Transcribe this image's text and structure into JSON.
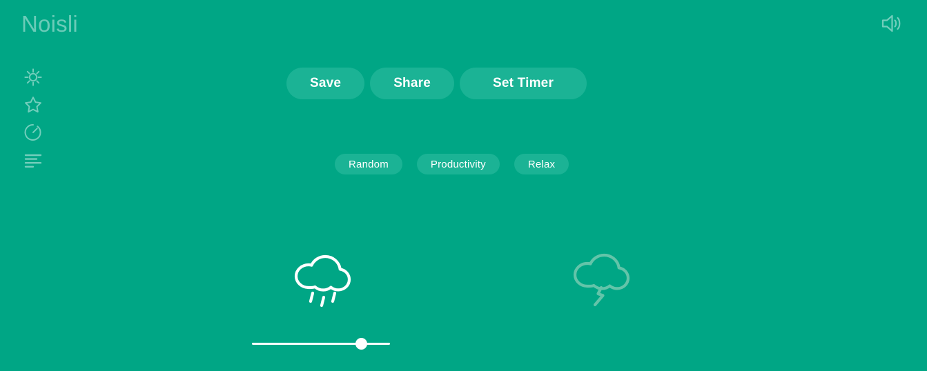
{
  "app": {
    "name": "Noisli",
    "background_color": "#00a685",
    "accent_color": "#1bb395",
    "text_color": "#ffffff"
  },
  "header": {
    "logo_text": "Noisli",
    "volume_icon": "speaker-volume-icon"
  },
  "sidebar": {
    "items": [
      {
        "name": "settings",
        "icon": "gear-icon",
        "label": "Settings"
      },
      {
        "name": "favorites",
        "icon": "star-icon",
        "label": "Favorites"
      },
      {
        "name": "timer",
        "icon": "timer-icon",
        "label": "Timer"
      },
      {
        "name": "text-editor",
        "icon": "text-lines-icon",
        "label": "Text Editor"
      }
    ]
  },
  "actions": {
    "buttons": [
      {
        "label": "Save",
        "name": "save-button"
      },
      {
        "label": "Share",
        "name": "share-button"
      },
      {
        "label": "Set Timer",
        "name": "set-timer-button"
      }
    ]
  },
  "presets": {
    "buttons": [
      {
        "label": "Random",
        "name": "preset-random"
      },
      {
        "label": "Productivity",
        "name": "preset-productivity"
      },
      {
        "label": "Relax",
        "name": "preset-relax"
      }
    ]
  },
  "sounds": [
    {
      "name": "rain",
      "icon": "rain-cloud-icon",
      "active": true,
      "icon_color": "#ffffff",
      "volume_percent": 79,
      "slider_visible": true
    },
    {
      "name": "thunderstorm",
      "icon": "thunderstorm-cloud-icon",
      "active": false,
      "icon_color": "#63c4a9",
      "volume_percent": 0,
      "slider_visible": false
    }
  ]
}
